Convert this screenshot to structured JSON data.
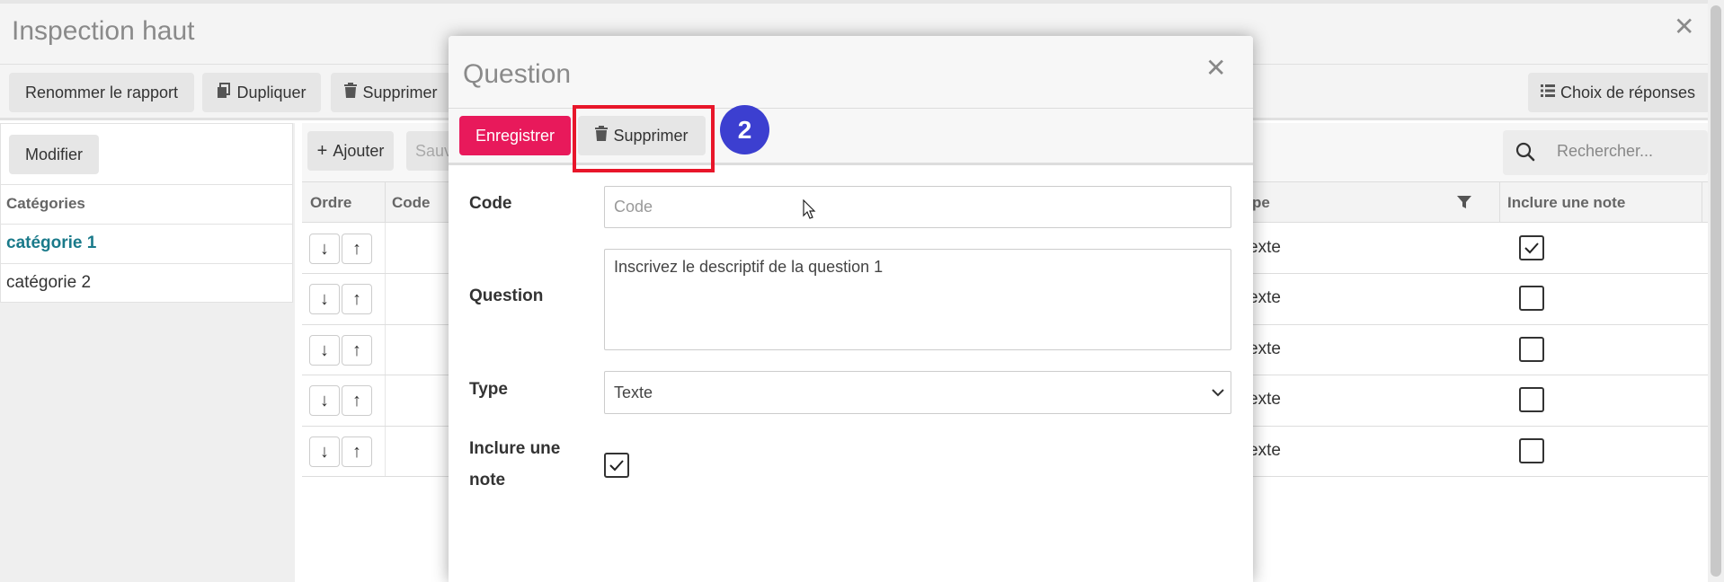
{
  "background": {
    "window_title": "Inspection haut",
    "toolbar": {
      "rename_label": "Renommer le rapport",
      "duplicate_label": "Dupliquer",
      "delete_label": "Supprimer",
      "answers_label": "Choix de réponses"
    },
    "sidebar": {
      "modify_label": "Modifier",
      "categories_header": "Catégories",
      "items": [
        {
          "label": "catégorie 1",
          "active": true
        },
        {
          "label": "catégorie 2",
          "active": false
        }
      ]
    },
    "grid": {
      "add_label": "Ajouter",
      "save_label_partial": "Sauv",
      "search_placeholder": "Rechercher...",
      "columns": [
        "Ordre",
        "Code",
        "pe",
        "Inclure une note"
      ],
      "rows": [
        {
          "type": "exte",
          "include_note": true
        },
        {
          "type": "exte",
          "include_note": false
        },
        {
          "type": "exte",
          "include_note": false
        },
        {
          "type": "exte",
          "include_note": false
        },
        {
          "type": "exte",
          "include_note": false
        }
      ]
    }
  },
  "modal": {
    "title": "Question",
    "save_label": "Enregistrer",
    "delete_label": "Supprimer",
    "step_number": "2",
    "fields": {
      "code_label": "Code",
      "code_placeholder": "Code",
      "code_value": "",
      "question_label": "Question",
      "question_value": "Inscrivez le descriptif de la question 1",
      "type_label": "Type",
      "type_value": "Texte",
      "include_note_label_line1": "Inclure une",
      "include_note_label_line2": "note",
      "include_note_checked": true
    }
  },
  "colors": {
    "primary_button": "#e8195b",
    "highlight_border": "#e8162a",
    "step_badge": "#3c3fd0",
    "active_category": "#1a7a8a"
  }
}
